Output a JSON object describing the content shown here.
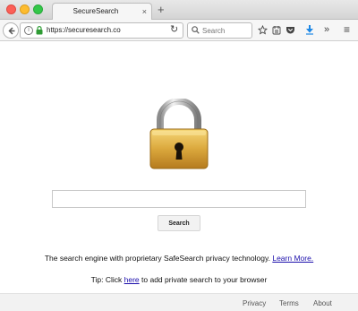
{
  "browser": {
    "tab_title": "SecureSearch",
    "tab_close": "×",
    "new_tab": "+",
    "url": "https://securesearch.co",
    "search_placeholder": "Search",
    "more_tools": "»",
    "menu": "≡"
  },
  "main": {
    "search_button_label": "Search",
    "tagline_text": "The search engine with proprietary SafeSearch privacy technology.",
    "learn_more_label": "Learn More.",
    "tip_prefix": "Tip: Click",
    "tip_link_label": "here",
    "tip_suffix": "to add private search to your browser"
  },
  "footer": {
    "links": [
      "Privacy",
      "Terms",
      "About"
    ]
  },
  "colors": {
    "link": "#1a0dab",
    "lock_gold": "#d9a73e",
    "shackle": "#b9b9b9"
  },
  "icons": [
    "back-arrow-icon",
    "info-icon",
    "secure-lock-icon",
    "reload-icon",
    "search-icon",
    "star-icon",
    "reading-list-icon",
    "pocket-icon",
    "download-icon",
    "padlock-icon"
  ]
}
